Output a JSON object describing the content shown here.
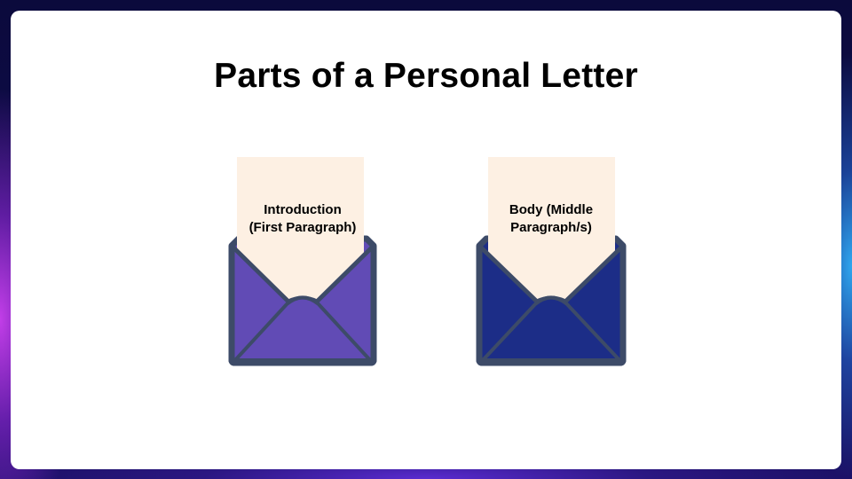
{
  "slide": {
    "title": "Parts of a Personal Letter"
  },
  "envelopes": [
    {
      "text": "Introduction\n(First Paragraph)",
      "color": "#614bb5"
    },
    {
      "text": "Body (Middle\nParagraph/s)",
      "color": "#1c2d87"
    }
  ],
  "colors": {
    "paper": "#fdf0e3",
    "outline": "#3d4b68"
  }
}
